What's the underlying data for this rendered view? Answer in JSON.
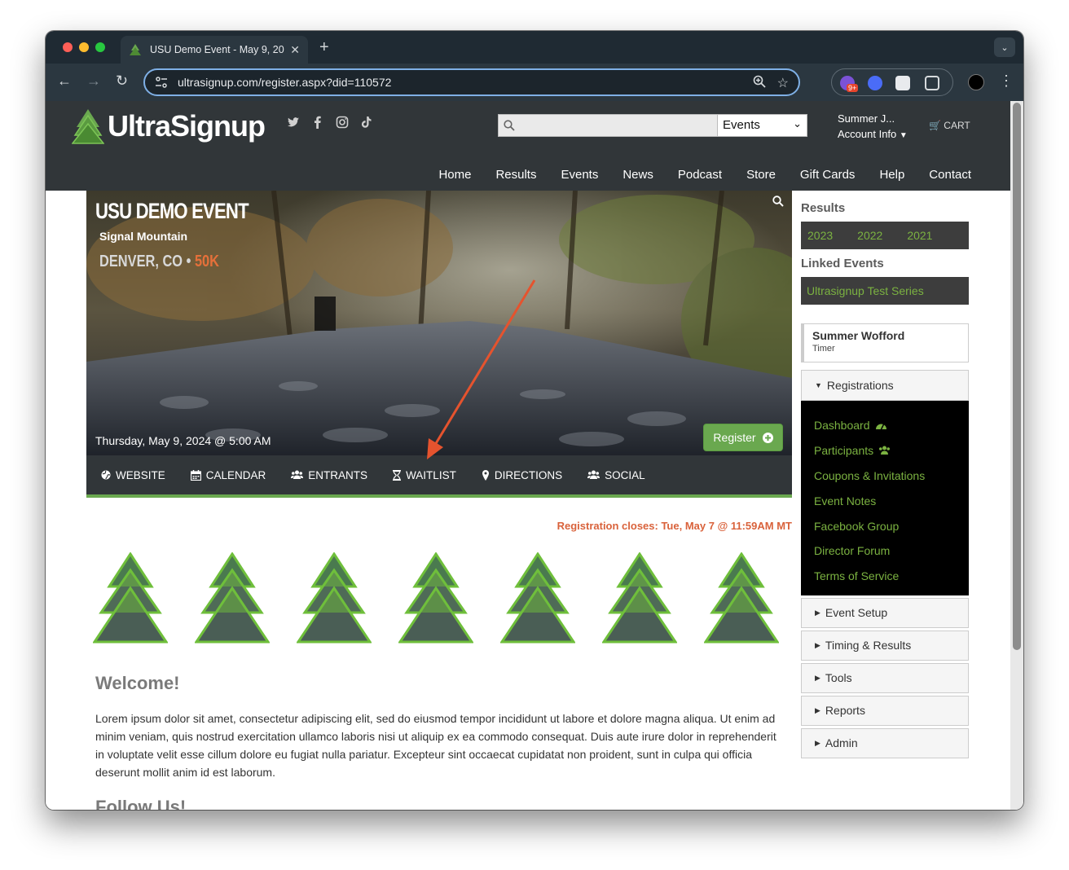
{
  "browser": {
    "tab_title": "USU Demo Event - May 9, 20",
    "new_tab_symbol": "+",
    "url": "ultrasignup.com/register.aspx?did=110572",
    "ext_badge": "9+"
  },
  "header": {
    "logo_text": "UltraSignup",
    "search": {
      "placeholder": "",
      "category": "Events"
    },
    "account_name": "Summer J...",
    "account_label": "Account Info",
    "cart_label": "CART",
    "nav": [
      "Home",
      "Results",
      "Events",
      "News",
      "Podcast",
      "Store",
      "Gift Cards",
      "Help",
      "Contact"
    ]
  },
  "hero": {
    "title": "USU DEMO EVENT",
    "subtitle": "Signal Mountain",
    "location": "DENVER, CO",
    "separator": "•",
    "distance": "50K",
    "date": "Thursday, May 9, 2024 @ 5:00 AM",
    "register_label": "Register"
  },
  "event_nav": [
    {
      "icon": "globe-icon",
      "label": "WEBSITE"
    },
    {
      "icon": "calendar-icon",
      "label": "CALENDAR"
    },
    {
      "icon": "users-icon",
      "label": "ENTRANTS"
    },
    {
      "icon": "hourglass-icon",
      "label": "WAITLIST"
    },
    {
      "icon": "map-pin-icon",
      "label": "DIRECTIONS"
    },
    {
      "icon": "users-icon",
      "label": "SOCIAL"
    }
  ],
  "registration_closes": "Registration closes: Tue, May 7 @ 11:59AM MT",
  "content": {
    "welcome_heading": "Welcome!",
    "welcome_body": "Lorem ipsum dolor sit amet, consectetur adipiscing elit, sed do eiusmod tempor incididunt ut labore et dolore magna aliqua. Ut enim ad minim veniam, quis nostrud exercitation ullamco laboris nisi ut aliquip ex ea commodo consequat. Duis aute irure dolor in reprehenderit in voluptate velit esse cillum dolore eu fugiat nulla pariatur. Excepteur sint occaecat cupidatat non proident, sunt in culpa qui officia deserunt mollit anim id est laborum.",
    "follow_heading": "Follow Us!"
  },
  "sidebar": {
    "results_heading": "Results",
    "result_years": [
      "2023",
      "2022",
      "2021"
    ],
    "linked_heading": "Linked Events",
    "linked_event": "Ultrasignup Test Series",
    "user_name": "Summer Wofford",
    "user_role": "Timer",
    "registrations_label": "Registrations",
    "registration_links": [
      "Dashboard",
      "Participants",
      "Coupons & Invitations",
      "Event Notes",
      "Facebook Group",
      "Director Forum",
      "Terms of Service"
    ],
    "sections": [
      "Event Setup",
      "Timing & Results",
      "Tools",
      "Reports",
      "Admin"
    ]
  },
  "colors": {
    "brand_green": "#6aa84f",
    "link_green": "#7bb241",
    "header_bg": "#313639",
    "annotation_arrow": "#e5532e",
    "alert_text": "#d9623b"
  }
}
